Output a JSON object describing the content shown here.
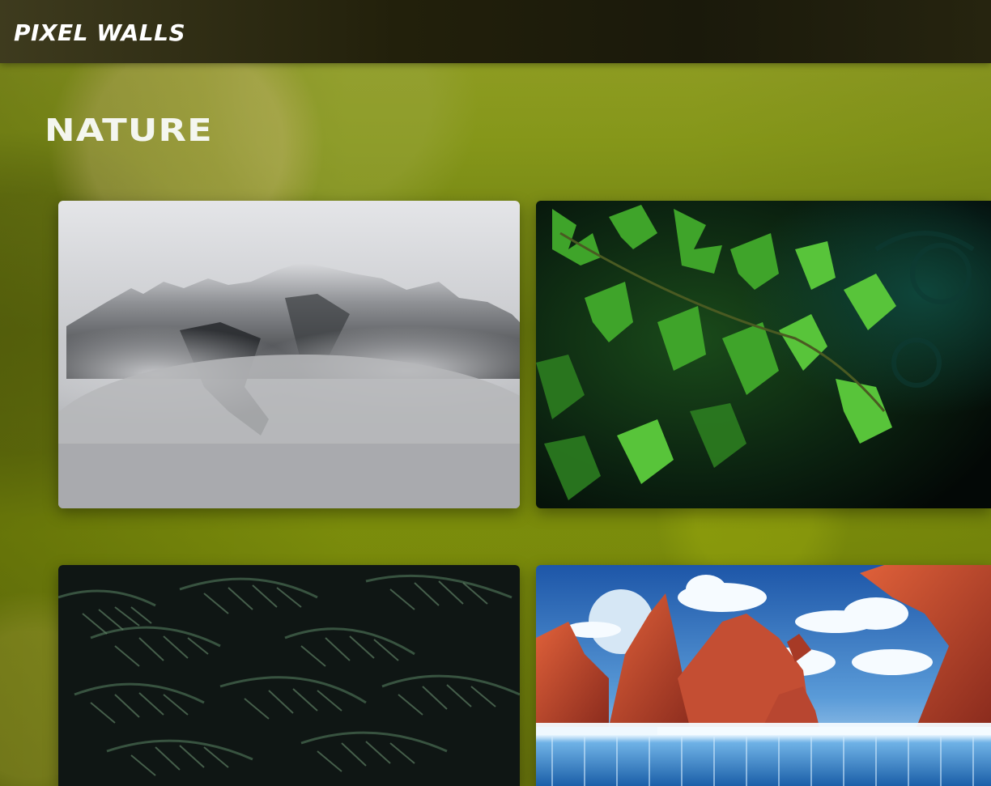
{
  "app": {
    "brand": "PIXEL WALLS"
  },
  "section": {
    "title": "NATURE"
  },
  "gallery": {
    "items": [
      {
        "icon": "misty-mountain-image"
      },
      {
        "icon": "green-leaves-image"
      },
      {
        "icon": "fern-foliage-image"
      },
      {
        "icon": "fantasy-waterfall-image"
      }
    ]
  },
  "colors": {
    "header_bg": "#1f1e0b",
    "background": "#7f8f18",
    "title_text": "#ffffff"
  }
}
